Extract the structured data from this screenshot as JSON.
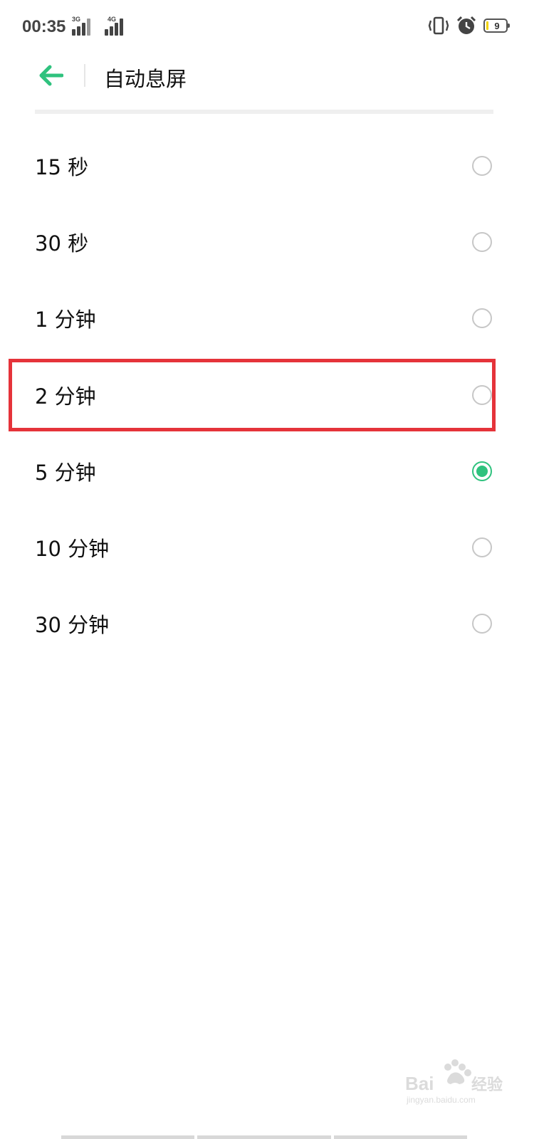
{
  "status_bar": {
    "time": "00:35",
    "signal1_label": "3G",
    "signal2_label": "4G",
    "battery_level": "9",
    "icons": [
      "vibrate-icon",
      "alarm-icon",
      "battery-icon"
    ]
  },
  "header": {
    "title": "自动息屏",
    "back_icon": "back-arrow-icon"
  },
  "options": [
    {
      "label": "15 秒",
      "selected": false
    },
    {
      "label": "30 秒",
      "selected": false
    },
    {
      "label": "1 分钟",
      "selected": false
    },
    {
      "label": "2 分钟",
      "selected": false
    },
    {
      "label": "5 分钟",
      "selected": true
    },
    {
      "label": "10 分钟",
      "selected": false
    },
    {
      "label": "30 分钟",
      "selected": false
    }
  ],
  "colors": {
    "accent": "#2fc27e",
    "highlight": "#e5333a",
    "radio_border": "#c7c7c7"
  }
}
